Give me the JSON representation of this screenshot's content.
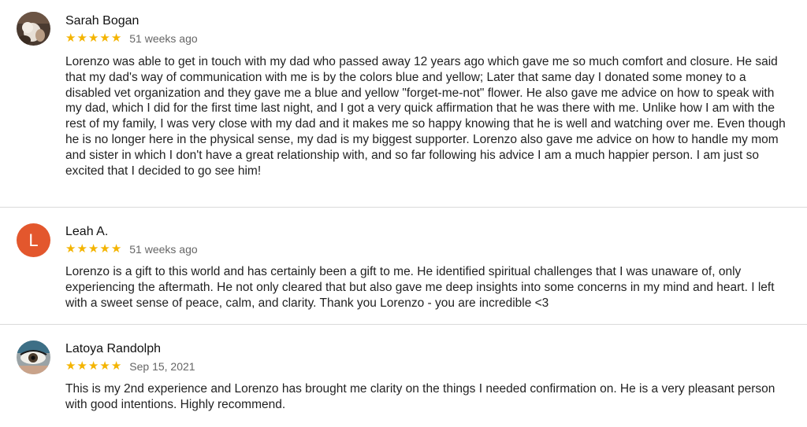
{
  "reviews": [
    {
      "author": "Sarah Bogan",
      "rating": 5,
      "stars": [
        "★",
        "★",
        "★",
        "★",
        "★"
      ],
      "date": "51 weeks ago",
      "avatar_type": "photo",
      "text": "Lorenzo was able to get in touch with my dad who passed away 12 years ago which gave me so much comfort and closure. He said that my dad's way of communication with me is by the colors blue and yellow; Later that same day I donated some money to a disabled vet organization and they gave me a blue and yellow \"forget-me-not\" flower. He also gave me advice on how to speak with my dad, which I did for the first time last night, and I got a very quick affirmation that he was there with me. Unlike how I am with the rest of my family, I was very close with my dad and it makes me so happy knowing that he is well and watching over me. Even though he is no longer here in the physical sense, my dad is my biggest supporter. Lorenzo also gave me advice on how to handle my mom and sister in which I don't have a great relationship with, and so far following his advice I am a much happier person. I am just so excited that I decided to go see him!"
    },
    {
      "author": "Leah A.",
      "rating": 5,
      "stars": [
        "★",
        "★",
        "★",
        "★",
        "★"
      ],
      "date": "51 weeks ago",
      "avatar_type": "letter",
      "avatar_letter": "L",
      "avatar_color": "#e3572d",
      "text": "Lorenzo is a gift to this world and has certainly been a gift to me. He identified spiritual challenges that I was unaware of, only experiencing the aftermath. He not only cleared that but also gave me deep insights into some concerns in my mind and heart. I left with a sweet sense of peace, calm, and clarity. Thank you Lorenzo - you are incredible <3"
    },
    {
      "author": "Latoya Randolph",
      "rating": 5,
      "stars": [
        "★",
        "★",
        "★",
        "★",
        "★"
      ],
      "date": "Sep 15, 2021",
      "avatar_type": "photo",
      "text": "This is my 2nd experience and Lorenzo has brought me clarity on the things I needed confirmation on. He is a very pleasant person with good intentions. Highly recommend."
    }
  ],
  "colors": {
    "star": "#f4b400",
    "divider": "#dadada",
    "avatar_letter_bg": "#e3572d"
  }
}
